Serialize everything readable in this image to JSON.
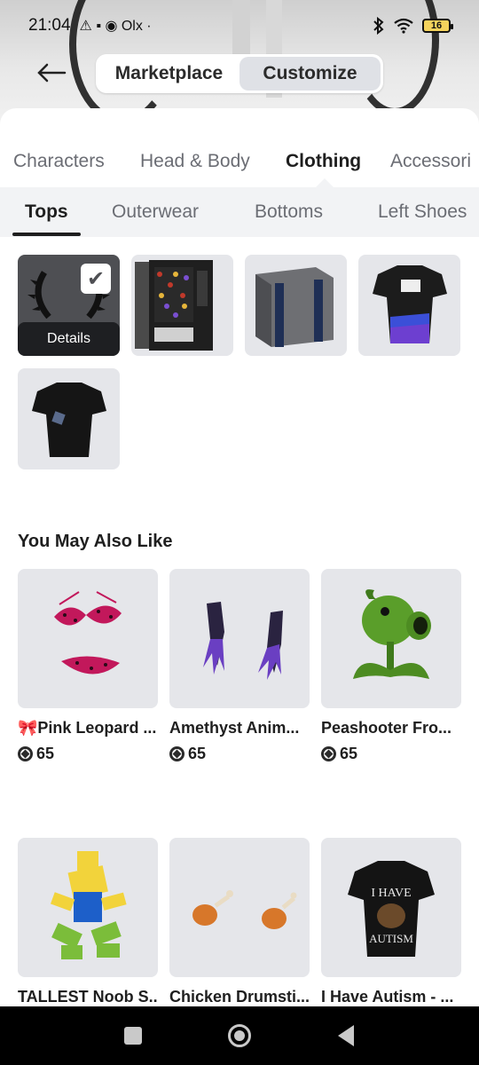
{
  "status_bar": {
    "time": "21:04",
    "left_icons": "⚠ ▪ ◉ Olx ·",
    "battery": "16"
  },
  "header": {
    "back_icon": "back-arrow-icon",
    "modes": [
      {
        "label": "Marketplace",
        "active": false
      },
      {
        "label": "Customize",
        "active": true
      }
    ]
  },
  "category_tabs": [
    "Characters",
    "Head & Body",
    "Clothing",
    "Accessori"
  ],
  "active_category": "Clothing",
  "sub_tabs": [
    "Tops",
    "Outerwear",
    "Bottoms",
    "Left Shoes"
  ],
  "active_sub_tab": "Tops",
  "owned_items": [
    {
      "name": "spiked-horns",
      "selected": true,
      "details_label": "Details"
    },
    {
      "name": "vending-machine",
      "selected": false
    },
    {
      "name": "gray-box",
      "selected": false
    },
    {
      "name": "graphic-shirt",
      "selected": false
    },
    {
      "name": "black-tshirt",
      "selected": false
    }
  ],
  "recommendations": {
    "title": "You May Also Like",
    "items": [
      {
        "name": "🎀Pink Leopard ...",
        "price": "65"
      },
      {
        "name": "Amethyst Anim...",
        "price": "65"
      },
      {
        "name": "Peashooter Fro...",
        "price": "65"
      },
      {
        "name": "TALLEST Noob S...",
        "price": ""
      },
      {
        "name": "Chicken Drumsti...",
        "price": ""
      },
      {
        "name": "I Have Autism - ...",
        "price": ""
      }
    ]
  },
  "tshirt_print": {
    "line1": "I HAVE",
    "line2": "AUTISM"
  },
  "colors": {
    "accent_selected": "#4e4f53",
    "tile_bg": "#e5e6ea",
    "subbar_bg": "#f2f3f5"
  }
}
